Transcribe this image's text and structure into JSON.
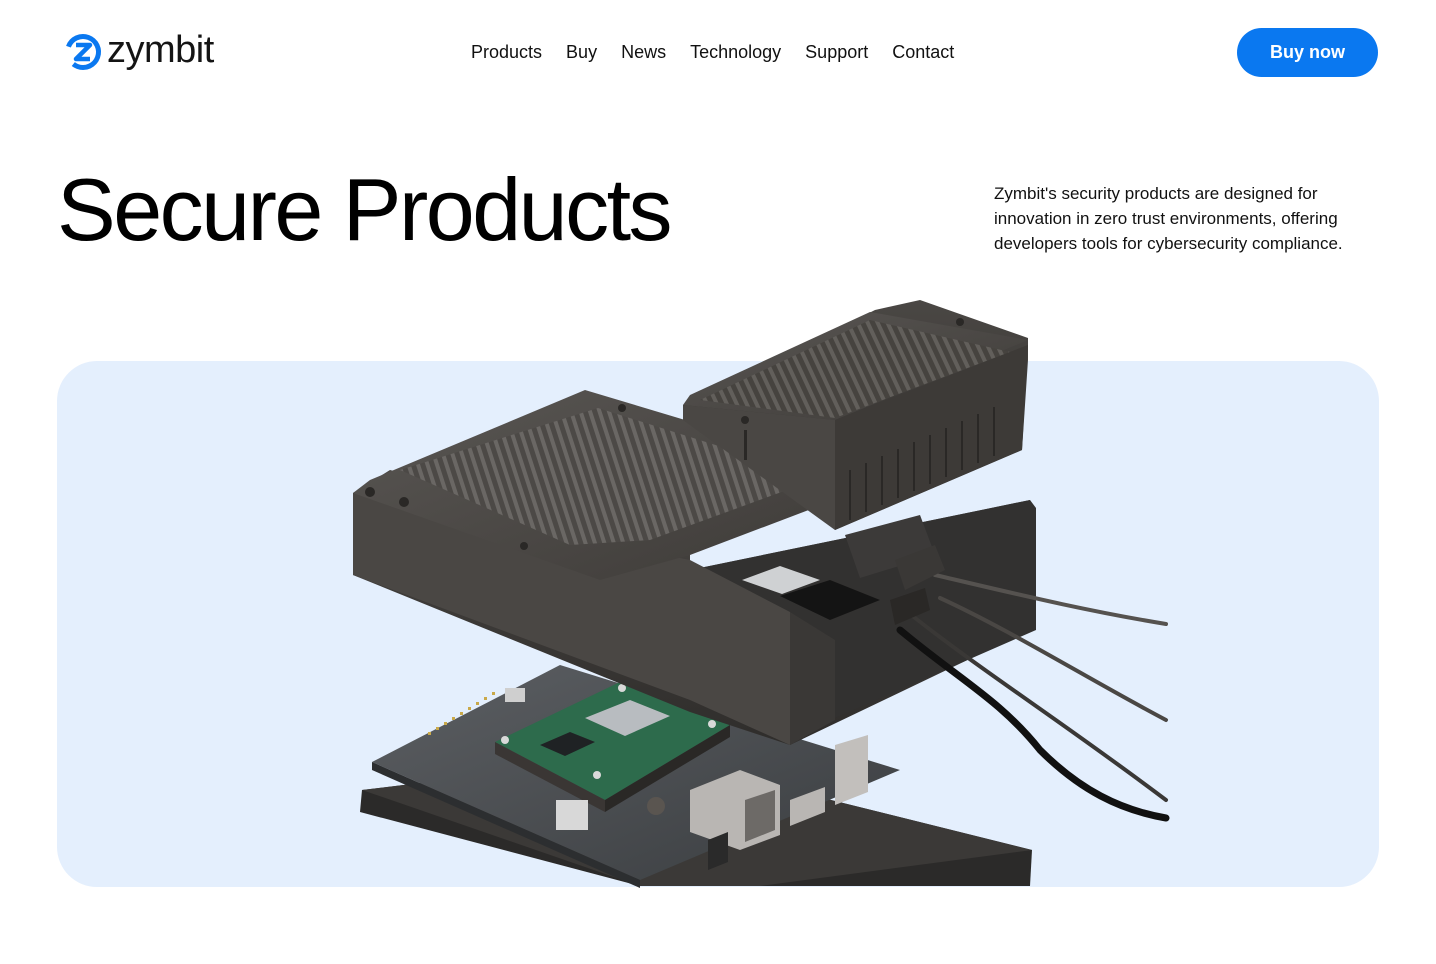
{
  "brand": {
    "name": "zymbit",
    "accent_color": "#0a78f0",
    "logo_icon": "zymbit-logo-icon"
  },
  "nav": {
    "items": [
      {
        "label": "Products"
      },
      {
        "label": "Buy"
      },
      {
        "label": "News"
      },
      {
        "label": "Technology"
      },
      {
        "label": "Support"
      },
      {
        "label": "Contact"
      }
    ]
  },
  "cta": {
    "label": "Buy now"
  },
  "hero": {
    "title": "Secure Products",
    "description": "Zymbit's security products are designed for innovation in zero trust environments, offering developers tools for cybersecurity compliance.",
    "background_color": "#e4effd",
    "image_subject": "exploded-enclosure-with-circuit-board-image"
  }
}
